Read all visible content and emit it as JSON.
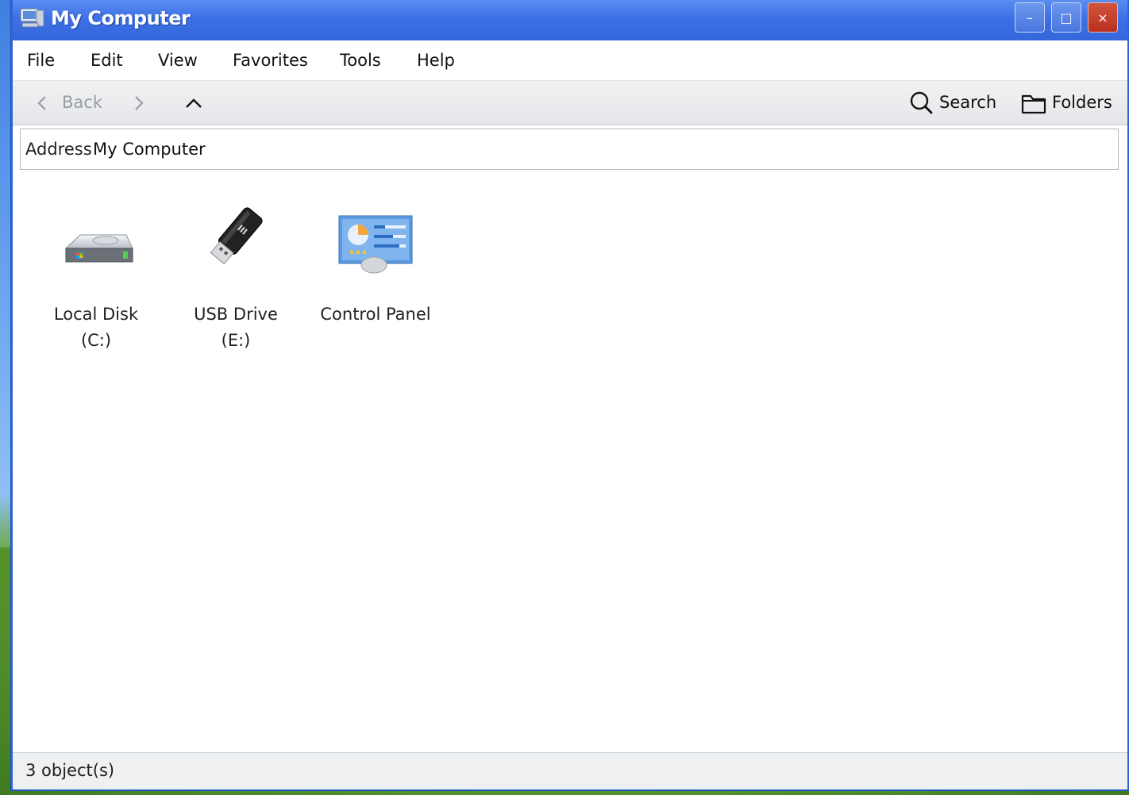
{
  "window": {
    "title": "My Computer",
    "minimize_label": "–",
    "maximize_label": "□",
    "close_label": "×"
  },
  "menubar": {
    "items": [
      "File",
      "Edit",
      "View",
      "Favorites",
      "Tools",
      "Help"
    ]
  },
  "toolbar": {
    "back_label": "Back",
    "search_label": "Search",
    "folders_label": "Folders"
  },
  "address": {
    "label": "Address",
    "value": "My Computer"
  },
  "items": [
    {
      "label_line1": "Local Disk",
      "label_line2": "(C:)",
      "icon": "hard-disk-icon"
    },
    {
      "label_line1": "USB Drive",
      "label_line2": "(E:)",
      "icon": "usb-drive-icon"
    },
    {
      "label_line1": "Control Panel",
      "label_line2": "",
      "icon": "control-panel-icon"
    }
  ],
  "status": {
    "text": "3 object(s)"
  },
  "colors": {
    "titlebar": "#3d70e5",
    "close_button": "#c13a27",
    "window_border": "#2f66d6"
  }
}
